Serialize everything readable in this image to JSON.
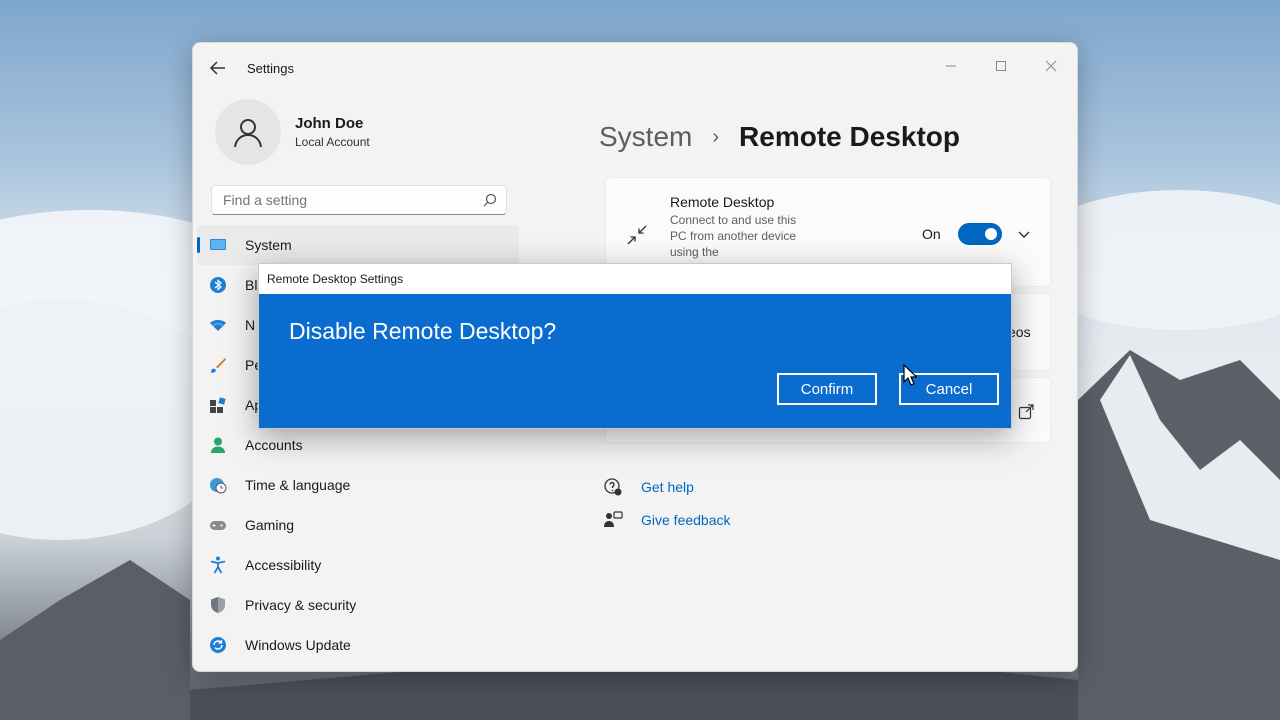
{
  "window": {
    "title": "Settings",
    "controls": [
      "minimize",
      "maximize",
      "close"
    ]
  },
  "profile": {
    "name": "John Doe",
    "account_type": "Local Account"
  },
  "search": {
    "placeholder": "Find a setting"
  },
  "nav": {
    "items": [
      {
        "label": "System",
        "icon": "monitor-icon",
        "active": true
      },
      {
        "label": "Bl",
        "icon": "bluetooth-icon"
      },
      {
        "label": "N",
        "icon": "wifi-icon"
      },
      {
        "label": "Pe",
        "icon": "brush-icon"
      },
      {
        "label": "Ap",
        "icon": "apps-icon"
      },
      {
        "label": "Accounts",
        "icon": "person-icon"
      },
      {
        "label": "Time & language",
        "icon": "globe-clock-icon"
      },
      {
        "label": "Gaming",
        "icon": "gamepad-icon"
      },
      {
        "label": "Accessibility",
        "icon": "accessibility-icon"
      },
      {
        "label": "Privacy & security",
        "icon": "shield-icon"
      },
      {
        "label": "Windows Update",
        "icon": "update-icon"
      }
    ]
  },
  "breadcrumb": {
    "parent": "System",
    "separator": "›",
    "current": "Remote Desktop"
  },
  "remote_desktop_card": {
    "title": "Remote Desktop",
    "description": "Connect to and use this PC from another device using the",
    "toggle_label": "On",
    "toggle_on": true
  },
  "card2": {
    "partial_text": "eos"
  },
  "help": {
    "get_help": "Get help",
    "give_feedback": "Give feedback"
  },
  "dialog": {
    "title": "Remote Desktop Settings",
    "message": "Disable Remote Desktop?",
    "confirm_label": "Confirm",
    "cancel_label": "Cancel"
  },
  "colors": {
    "accent": "#0067c0",
    "dialog_bg": "#0a6ccf"
  }
}
